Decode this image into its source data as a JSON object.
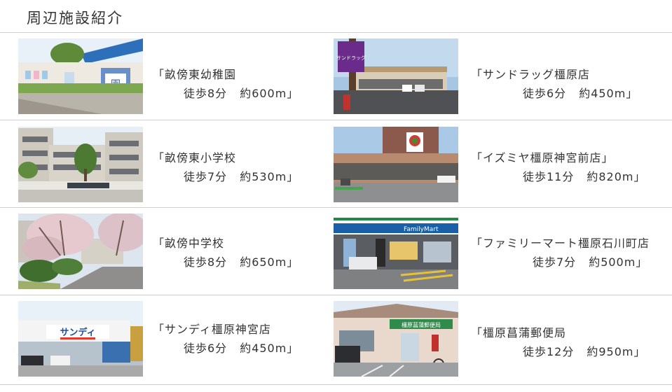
{
  "page": {
    "title": "周辺施設紹介"
  },
  "facilities": [
    {
      "name": "「畝傍東幼稚園",
      "walk": "徒歩8分",
      "distance": "約600m」"
    },
    {
      "name": "「サンドラッグ橿原店",
      "walk": "徒歩6分",
      "distance": "約450m」"
    },
    {
      "name": "「畝傍東小学校",
      "walk": "徒歩7分",
      "distance": "約530m」"
    },
    {
      "name": "「イズミヤ橿原神宮前店」",
      "walk": "徒歩11分",
      "distance": "約820m」"
    },
    {
      "name": "「畝傍中学校",
      "walk": "徒歩8分",
      "distance": "約650m」"
    },
    {
      "name": "「ファミリーマート橿原石川町店",
      "walk": "徒歩7分",
      "distance": "約500m」"
    },
    {
      "name": "「サンディ橿原神宮店",
      "walk": "徒歩6分",
      "distance": "約450m」"
    },
    {
      "name": "「橿原菖蒲郵便局",
      "walk": "徒歩12分",
      "distance": "約950m」"
    }
  ],
  "signs": {
    "sundrug": "サンドラッグ",
    "kindergarten": "園",
    "familymart": "FamilyMart",
    "sandi": "サンディ",
    "post_office": "橿原菖蒲郵便局"
  }
}
